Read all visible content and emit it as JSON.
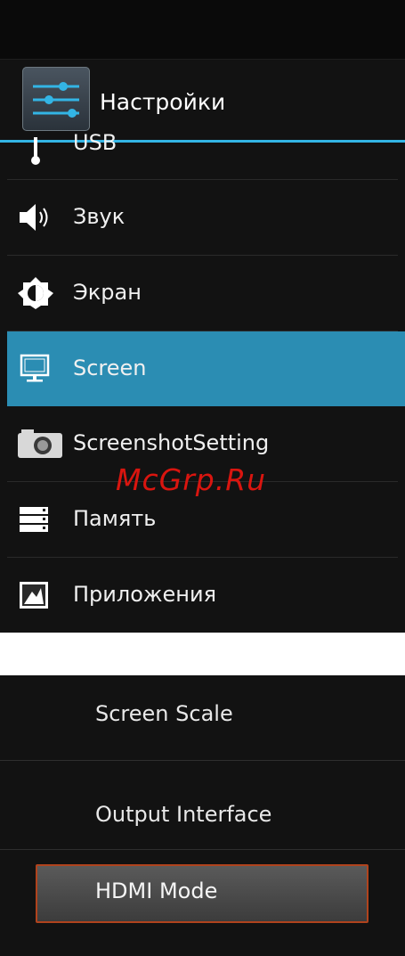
{
  "app": {
    "title": "Настройки"
  },
  "settings_list": [
    {
      "label": "USB",
      "icon": "usb-icon"
    },
    {
      "label": "Звук",
      "icon": "speaker-icon"
    },
    {
      "label": "Экран",
      "icon": "brightness-icon"
    },
    {
      "label": "Screen",
      "icon": "monitor-icon",
      "selected": true
    },
    {
      "label": "ScreenshotSetting",
      "icon": "camera-icon"
    },
    {
      "label": "Память",
      "icon": "storage-icon"
    },
    {
      "label": "Приложения",
      "icon": "apps-icon"
    }
  ],
  "watermark": "McGrp.Ru",
  "screen_options": [
    {
      "label": "Screen Scale"
    },
    {
      "label": "Output Interface"
    },
    {
      "label": "HDMI Mode"
    }
  ],
  "colors": {
    "accent": "#33b5e5",
    "selected_row": "#2b8db3",
    "background": "#121212",
    "watermark": "#d9150f",
    "button_border": "#b0431d"
  }
}
